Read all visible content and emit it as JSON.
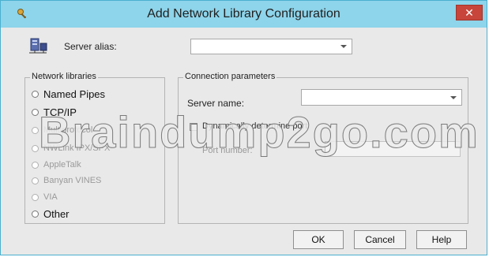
{
  "window": {
    "title": "Add Network Library Configuration",
    "close_symbol": "✕",
    "accent_color": "#8ed4ea",
    "close_color": "#c7453a"
  },
  "server_alias": {
    "label": "Server alias:",
    "value": ""
  },
  "network_libraries": {
    "title": "Network libraries",
    "options": [
      {
        "label": "Named Pipes",
        "enabled": true
      },
      {
        "label": "TCP/IP",
        "enabled": true
      },
      {
        "label": "Multiprotocol",
        "enabled": false
      },
      {
        "label": "NWLink IPX/SPX",
        "enabled": false
      },
      {
        "label": "AppleTalk",
        "enabled": false
      },
      {
        "label": "Banyan VINES",
        "enabled": false
      },
      {
        "label": "VIA",
        "enabled": false
      },
      {
        "label": "Other",
        "enabled": true
      }
    ]
  },
  "connection_parameters": {
    "title": "Connection parameters",
    "server_name_label": "Server name:",
    "server_name_value": "",
    "dynamic_port_label": "Dynamically determine port",
    "port_number_label": "Port number:",
    "port_number_value": ""
  },
  "buttons": {
    "ok": "OK",
    "cancel": "Cancel",
    "help": "Help"
  },
  "watermark": "Braindump2go.com",
  "icons": [
    "key-icon",
    "server-network-icon",
    "close-icon",
    "dropdown-arrow-icon"
  ]
}
